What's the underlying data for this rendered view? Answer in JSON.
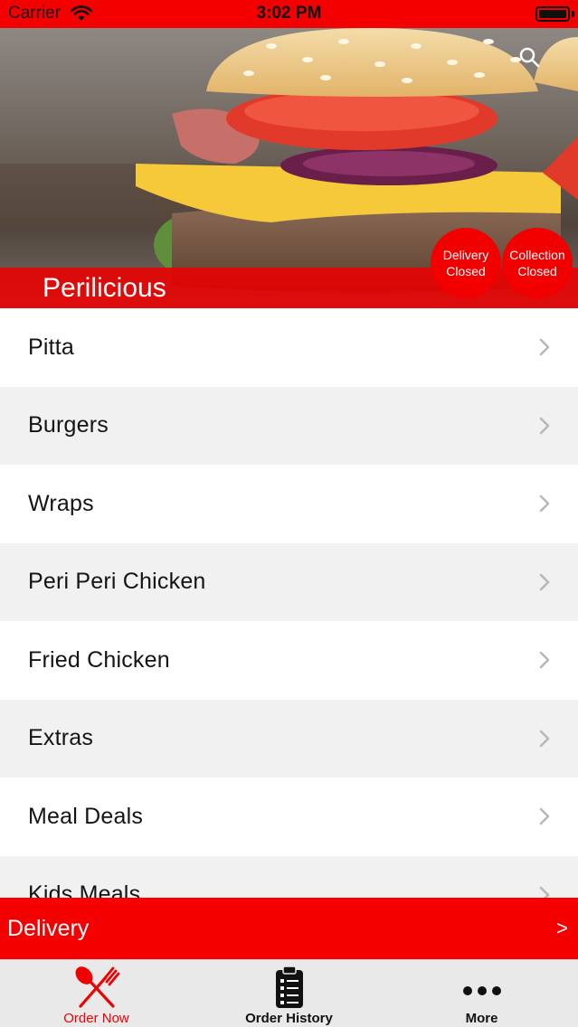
{
  "status_bar": {
    "carrier": "Carrier",
    "time": "3:02 PM",
    "icons": [
      "wifi-icon",
      "battery-icon"
    ]
  },
  "hero": {
    "restaurant_name": "Perilicious",
    "delivery_status": {
      "line1": "Delivery",
      "line2": "Closed"
    },
    "collection_status": {
      "line1": "Collection",
      "line2": "Closed"
    },
    "icons": [
      "search-icon"
    ]
  },
  "menu": {
    "categories": [
      {
        "label": "Pitta"
      },
      {
        "label": "Burgers"
      },
      {
        "label": "Wraps"
      },
      {
        "label": "Peri Peri Chicken"
      },
      {
        "label": "Fried Chicken"
      },
      {
        "label": "Extras"
      },
      {
        "label": "Meal Deals"
      },
      {
        "label": "Kids Meals"
      }
    ]
  },
  "delivery_bar": {
    "label": "Delivery",
    "arrow": ">"
  },
  "tab_bar": {
    "tabs": [
      {
        "label": "Order Now",
        "icon": "fork-knife-icon",
        "active": true
      },
      {
        "label": "Order History",
        "icon": "clipboard-icon",
        "active": false
      },
      {
        "label": "More",
        "icon": "more-dots-icon",
        "active": false
      }
    ]
  },
  "colors": {
    "brand_red": "#f50000",
    "banner_red": "#eb0000",
    "row_alt": "#f1f1f2",
    "tab_bar_bg": "#e9e9ea",
    "active_tab": "#f00000"
  }
}
